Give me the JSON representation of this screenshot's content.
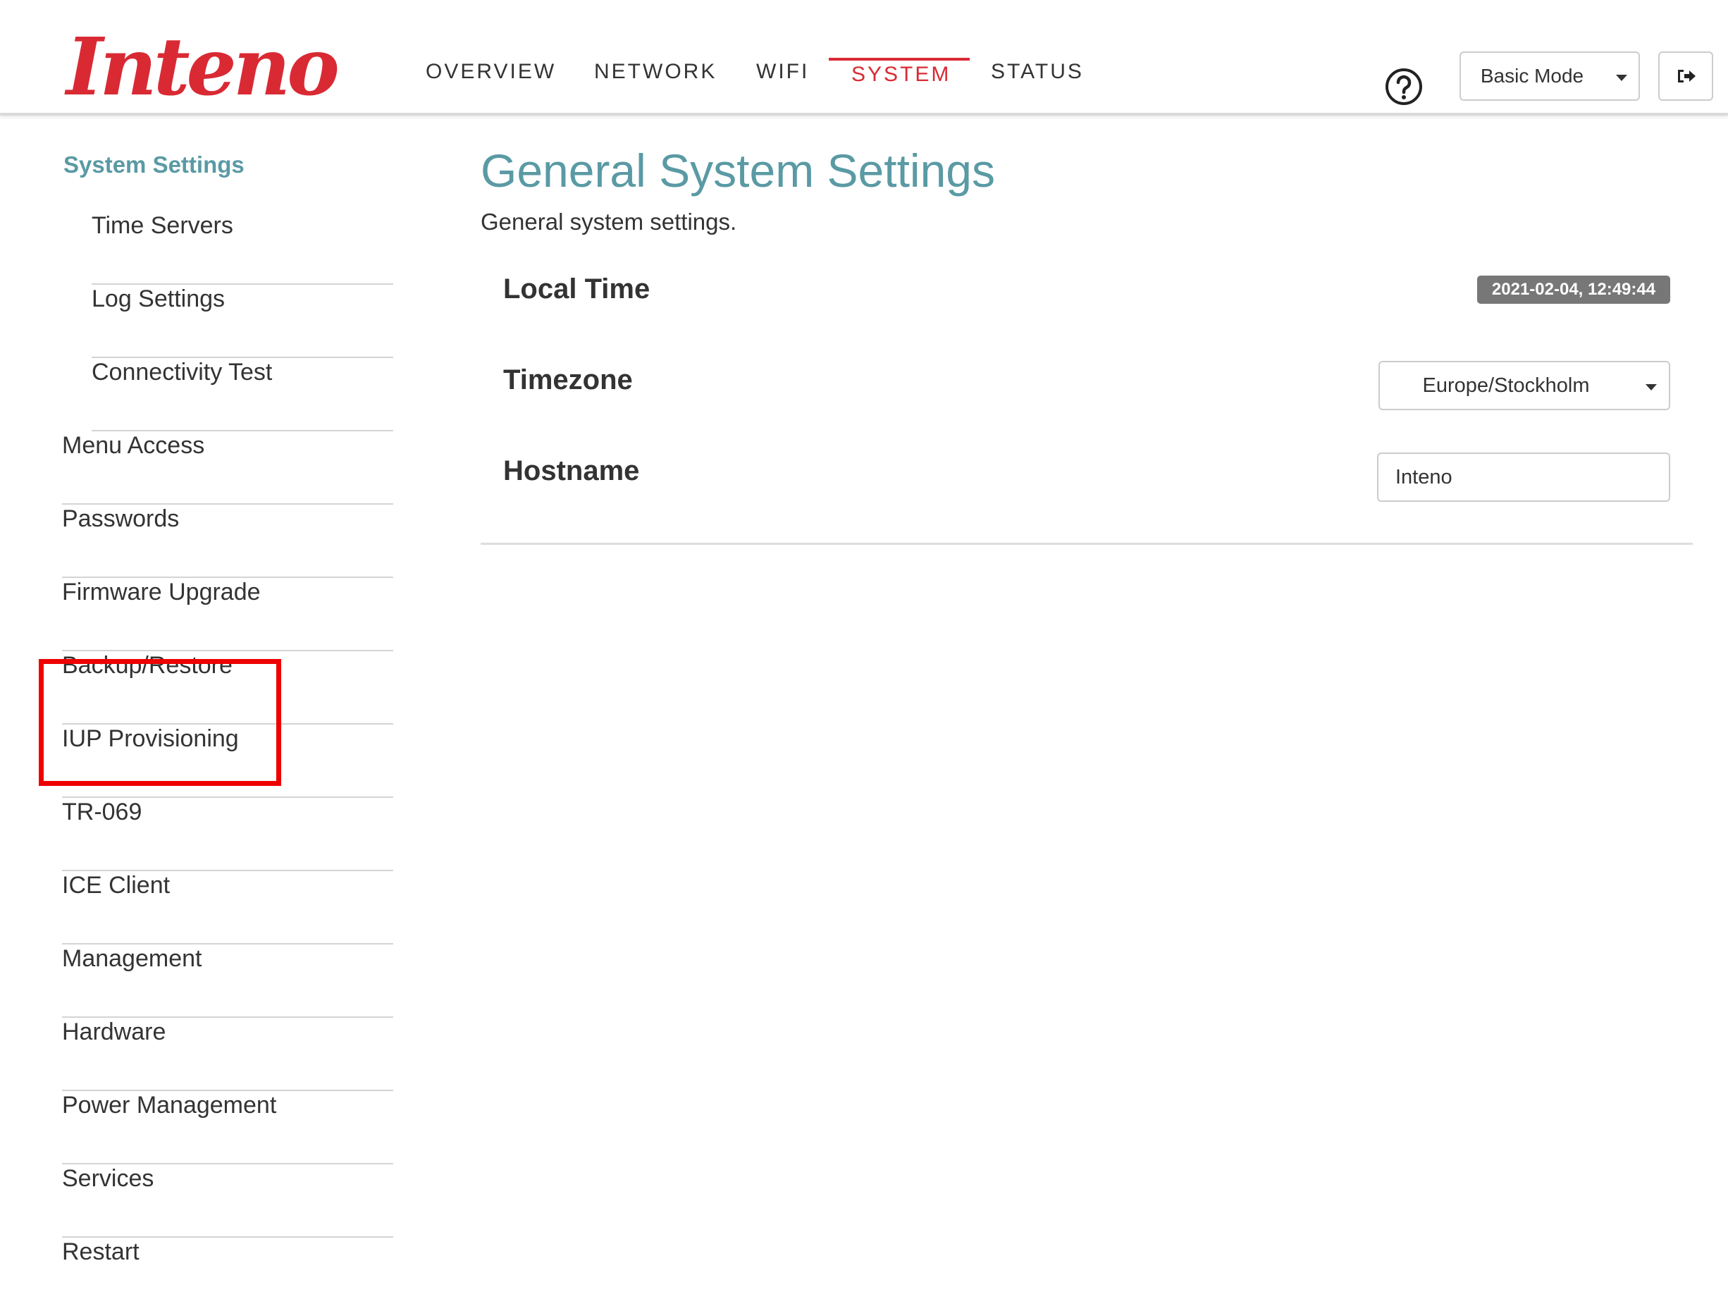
{
  "header": {
    "logo_text": "Inteno",
    "nav": [
      {
        "label": "OVERVIEW",
        "active": false
      },
      {
        "label": "NETWORK",
        "active": false
      },
      {
        "label": "WIFI",
        "active": false
      },
      {
        "label": "SYSTEM",
        "active": true
      },
      {
        "label": "STATUS",
        "active": false
      }
    ],
    "help_icon": "question-circle-icon",
    "mode_button_label": "Basic Mode",
    "logout_icon": "sign-out-icon"
  },
  "sidebar": {
    "heading": "System Settings",
    "sub_items": [
      {
        "label": "Time Servers"
      },
      {
        "label": "Log Settings"
      },
      {
        "label": "Connectivity Test"
      }
    ],
    "items": [
      {
        "label": "Menu Access"
      },
      {
        "label": "Passwords"
      },
      {
        "label": "Firmware Upgrade"
      },
      {
        "label": "Backup/Restore"
      },
      {
        "label": "IUP Provisioning"
      },
      {
        "label": "TR-069"
      },
      {
        "label": "ICE Client"
      },
      {
        "label": "Management"
      },
      {
        "label": "Hardware"
      },
      {
        "label": "Power Management"
      },
      {
        "label": "Services"
      },
      {
        "label": "Restart"
      }
    ]
  },
  "main": {
    "title": "General System Settings",
    "description": "General system settings.",
    "local_time_label": "Local Time",
    "local_time_value": "2021-02-04, 12:49:44",
    "timezone_label": "Timezone",
    "timezone_value": "Europe/Stockholm",
    "hostname_label": "Hostname",
    "hostname_value": "Inteno"
  },
  "colors": {
    "brand_red": "#d92a34",
    "accent_teal": "#5a9aa4",
    "highlight_red": "#ee0000",
    "badge_gray": "#777777"
  }
}
